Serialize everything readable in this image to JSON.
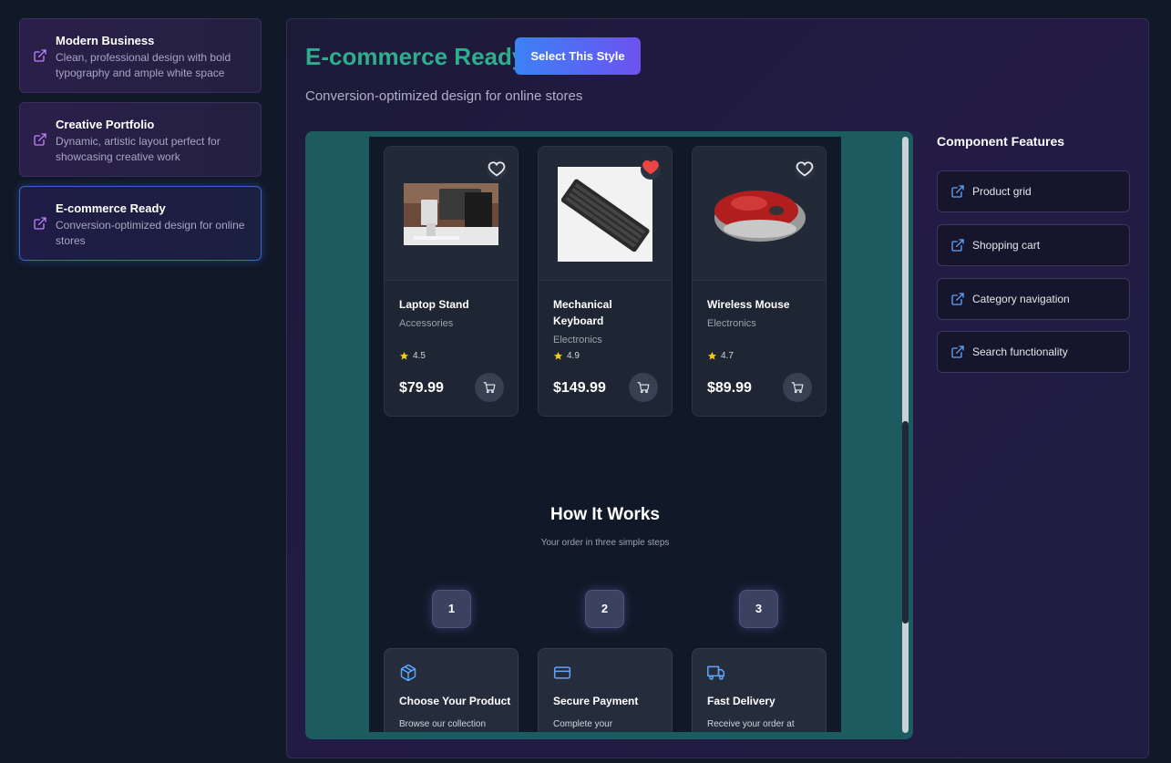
{
  "sidebar": {
    "styles": [
      {
        "title": "Modern Business",
        "desc_line1": "Clean, professional design with bold",
        "desc_line2": "typography and ample white space"
      },
      {
        "title": "Creative Portfolio",
        "desc_line1": "Dynamic, artistic layout perfect for",
        "desc_line2": "showcasing creative work"
      },
      {
        "title": "E-commerce Ready",
        "desc_line1": "Conversion-optimized design for online",
        "desc_line2": "stores"
      }
    ]
  },
  "main": {
    "title": "E-commerce Ready",
    "select_label": "Select This Style",
    "subtitle": "Conversion-optimized design for online stores"
  },
  "preview": {
    "products": [
      {
        "name": "Laptop Stand",
        "category": "Accessories",
        "rating": "4.5",
        "price": "$79.99"
      },
      {
        "name": "Mechanical Keyboard",
        "category": "Electronics",
        "rating": "4.9",
        "price": "$149.99"
      },
      {
        "name": "Wireless Mouse",
        "category": "Electronics",
        "rating": "4.7",
        "price": "$89.99"
      }
    ],
    "how_it_works": {
      "title": "How It Works",
      "subtitle": "Your order in three simple steps",
      "steps": [
        {
          "num": "1",
          "title": "Choose Your Product",
          "desc": "Browse our collection",
          "icon": "package-icon"
        },
        {
          "num": "2",
          "title": "Secure Payment",
          "desc": "Complete your",
          "icon": "credit-card-icon"
        },
        {
          "num": "3",
          "title": "Fast Delivery",
          "desc": "Receive your order at",
          "icon": "truck-icon"
        }
      ]
    }
  },
  "features": {
    "title": "Component Features",
    "items": [
      "Product grid",
      "Shopping cart",
      "Category navigation",
      "Search functionality"
    ]
  },
  "colors": {
    "accent_title": "#2fae8e",
    "button_gradient_start": "#3b82f6",
    "button_gradient_end": "#6d52f0",
    "preview_bg": "#1c5b5f",
    "icon_link": "#c084fc",
    "heart_active": "#ef4444",
    "star": "#facc15"
  }
}
